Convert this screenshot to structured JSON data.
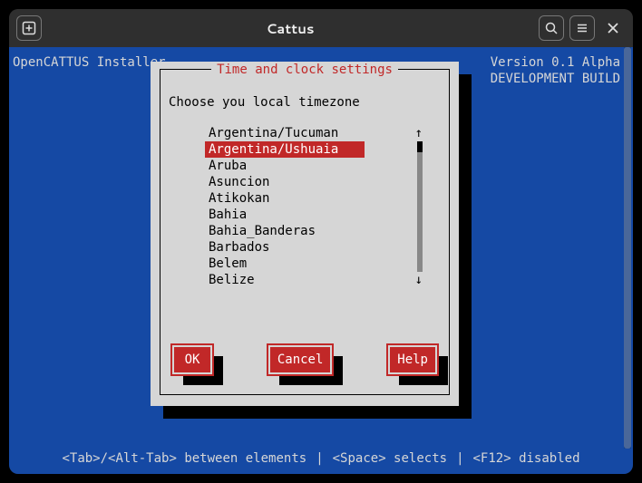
{
  "window": {
    "title": "Cattus"
  },
  "header": {
    "left": "OpenCATTUS Installer",
    "right_line1": "Version 0.1 Alpha",
    "right_line2": "DEVELOPMENT BUILD"
  },
  "dialog": {
    "title": "Time and clock settings",
    "prompt": "Choose you local timezone",
    "items": [
      "Argentina/Tucuman",
      "Argentina/Ushuaia",
      "Aruba",
      "Asuncion",
      "Atikokan",
      "Bahia",
      "Bahia_Banderas",
      "Barbados",
      "Belem",
      "Belize"
    ],
    "selected_index": 1,
    "buttons": {
      "ok": "OK",
      "cancel": "Cancel",
      "help": "Help"
    }
  },
  "footer": {
    "part1": "<Tab>/<Alt-Tab> between elements",
    "sep": "|",
    "part2": "<Space> selects",
    "part3": "<F12> disabled"
  },
  "icons": {
    "new_tab": "new-tab-icon",
    "search": "search-icon",
    "menu": "hamburger-icon",
    "close": "close-icon",
    "arrow_up": "↑",
    "arrow_down": "↓"
  },
  "colors": {
    "accent": "#c12828",
    "bluebg": "#1549a4",
    "panel": "#d6d6d6"
  }
}
